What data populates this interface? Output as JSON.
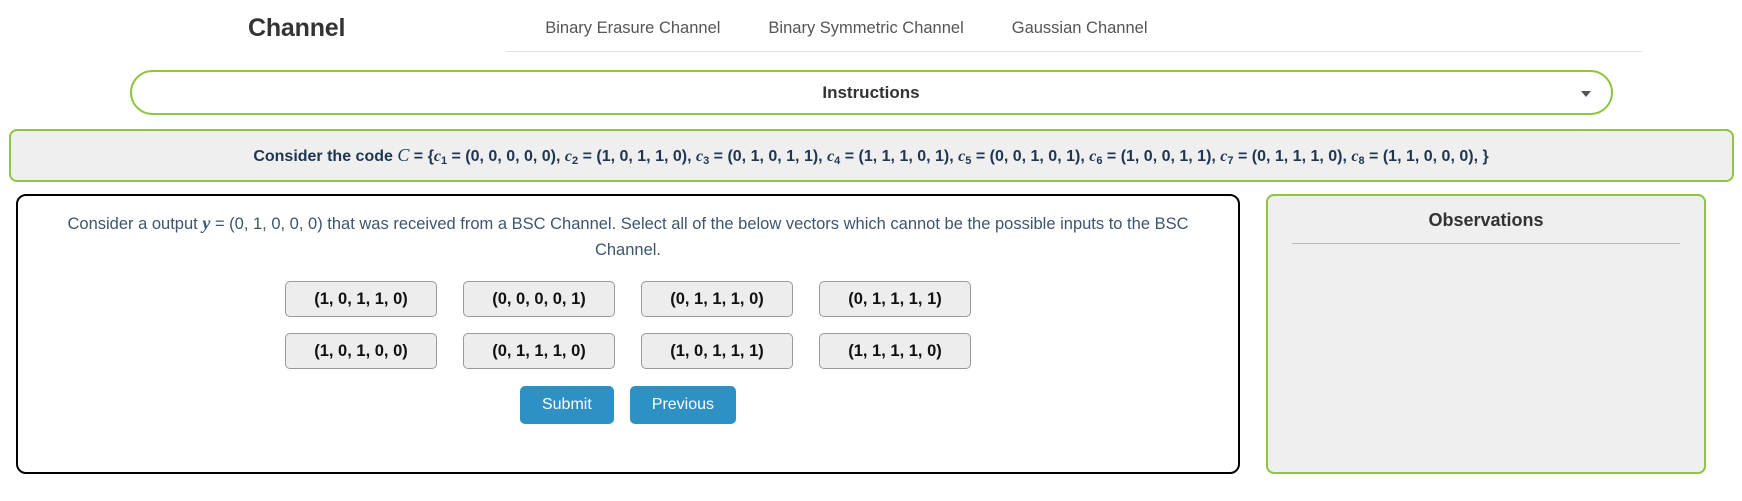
{
  "header": {
    "brand": "Channel",
    "nav": [
      {
        "label": "Binary Erasure Channel",
        "name": "nav-binary-erasure-channel"
      },
      {
        "label": "Binary Symmetric Channel",
        "name": "nav-binary-symmetric-channel"
      },
      {
        "label": "Gaussian Channel",
        "name": "nav-gaussian-channel"
      }
    ]
  },
  "instructions": {
    "title": "Instructions",
    "caret": "chevron-down-icon",
    "expanded": false
  },
  "code_banner": {
    "prefix": "Consider the code",
    "code_symbol": "C",
    "full_text": "Consider the code C = {c1 = (0, 0, 0, 0, 0), c2 = (1, 0, 1, 1, 0), c3 = (0, 1, 0, 1, 1), c4 = (1, 1, 1, 0, 1), c5 = (0, 0, 1, 0, 1), c6 = (1, 0, 0, 1, 1), c7 = (0, 1, 1, 1, 0), c8 = (1, 1, 0, 0, 0), }",
    "codewords": [
      {
        "name": "c",
        "index": "1",
        "value": "(0, 0, 0, 0, 0)"
      },
      {
        "name": "c",
        "index": "2",
        "value": "(1, 0, 1, 1, 0)"
      },
      {
        "name": "c",
        "index": "3",
        "value": "(0, 1, 0, 1, 1)"
      },
      {
        "name": "c",
        "index": "4",
        "value": "(1, 1, 1, 0, 1)"
      },
      {
        "name": "c",
        "index": "5",
        "value": "(0, 0, 1, 0, 1)"
      },
      {
        "name": "c",
        "index": "6",
        "value": "(1, 0, 0, 1, 1)"
      },
      {
        "name": "c",
        "index": "7",
        "value": "(0, 1, 1, 1, 0)"
      },
      {
        "name": "c",
        "index": "8",
        "value": "(1, 1, 0, 0, 0)"
      }
    ]
  },
  "question": {
    "part1": "Consider a output",
    "symbol": "y",
    "part2": "= (0, 1, 0, 0, 0) that was received from a BSC Channel. Select all of the below vectors which cannot be the possible inputs to the BSC Channel.",
    "full_text": "Consider a output y = (0, 1, 0, 0, 0) that was received from a BSC Channel. Select all of the below vectors which cannot be the possible inputs to the BSC Channel.",
    "received_vector": "(0, 1, 0, 0, 0)",
    "channel": "BSC Channel"
  },
  "options": [
    [
      {
        "label": "(1, 0, 1, 1, 0)",
        "name": "option-1-0-1-1-0"
      },
      {
        "label": "(0, 0, 0, 0, 1)",
        "name": "option-0-0-0-0-1"
      },
      {
        "label": "(0, 1, 1, 1, 0)",
        "name": "option-0-1-1-1-0"
      },
      {
        "label": "(0, 1, 1, 1, 1)",
        "name": "option-0-1-1-1-1"
      }
    ],
    [
      {
        "label": "(1, 0, 1, 0, 0)",
        "name": "option-1-0-1-0-0"
      },
      {
        "label": "(0, 1, 1, 1, 0)",
        "name": "option-0-1-1-1-0-b"
      },
      {
        "label": "(1, 0, 1, 1, 1)",
        "name": "option-1-0-1-1-1"
      },
      {
        "label": "(1, 1, 1, 1, 0)",
        "name": "option-1-1-1-1-0"
      }
    ]
  ],
  "actions": {
    "submit": "Submit",
    "previous": "Previous"
  },
  "observations": {
    "title": "Observations",
    "content": ""
  },
  "colors": {
    "accent_green": "#8dc63f",
    "button_blue": "#2f90c4",
    "panel_gray": "#efefef",
    "text_dark": "#333333",
    "question_text": "#3d566e",
    "code_text": "#1f3552"
  }
}
